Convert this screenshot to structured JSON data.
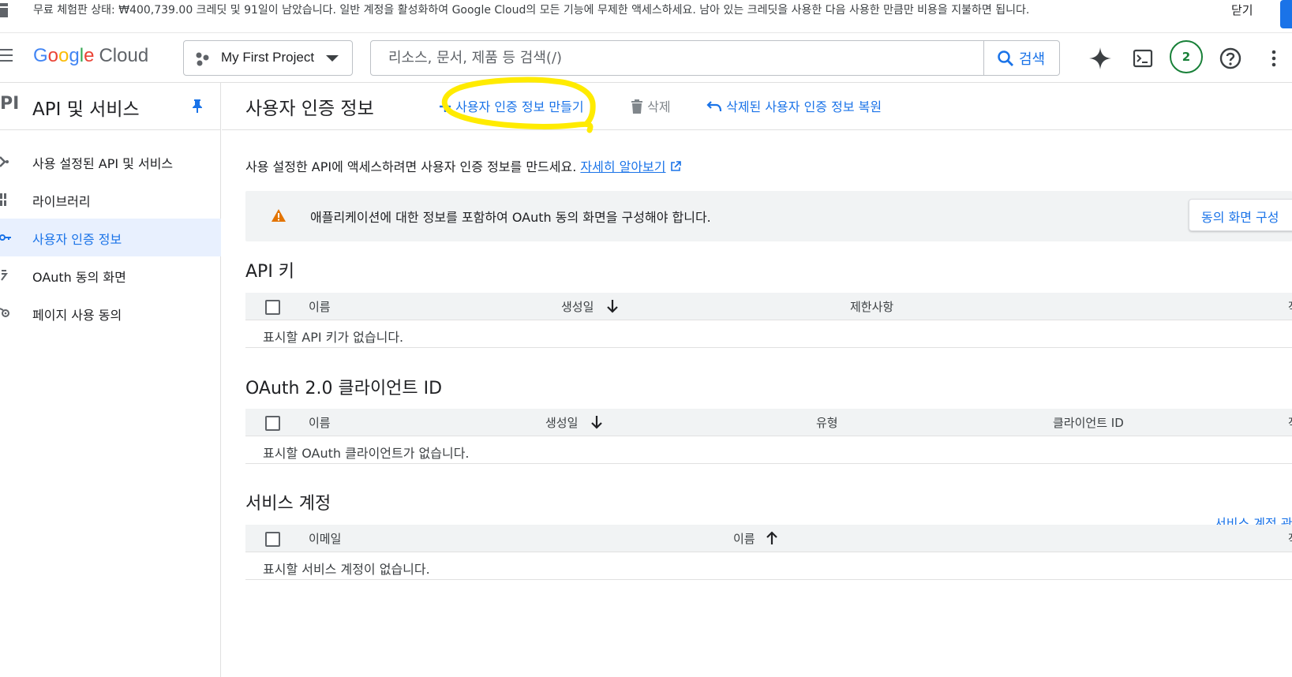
{
  "banner": {
    "message": "무료 체험판 상태: ₩400,739.00 크레딧 및 91일이 남았습니다. 일반 계정을 활성화하여 Google Cloud의 모든 기능에 무제한 액세스하세요. 남아 있는 크레딧을 사용한 다음 사용한 만큼만 비용을 지불하면 됩니다.",
    "close_label": "닫기"
  },
  "topbar": {
    "logo_google": "Google",
    "logo_cloud": "Cloud",
    "project_name": "My First Project",
    "search_placeholder": "리소스, 문서, 제품 등 검색(/)",
    "search_button": "검색",
    "notifications_count": "2",
    "icons": [
      "menu-icon",
      "gemini-icon",
      "cloud-shell-icon",
      "help-icon",
      "more-vert-icon"
    ]
  },
  "sidebar": {
    "api_badge": "PI",
    "title": "API 및 서비스",
    "items": [
      {
        "label": "사용 설정된 API 및 서비스",
        "icon": "enabled-apis-icon",
        "active": false
      },
      {
        "label": "라이브러리",
        "icon": "library-icon",
        "active": false
      },
      {
        "label": "사용자 인증 정보",
        "icon": "key-icon",
        "active": true
      },
      {
        "label": "OAuth 동의 화면",
        "icon": "oauth-icon",
        "active": false
      },
      {
        "label": "페이지 사용 동의",
        "icon": "settings-icon",
        "active": false
      }
    ]
  },
  "main": {
    "title": "사용자 인증 정보",
    "actions": {
      "create": "사용자 인증 정보 만들기",
      "delete": "삭제",
      "restore": "삭제된 사용자 인증 정보 복원"
    },
    "intro_text": "사용 설정한 API에 액세스하려면 사용자 인증 정보를 만드세요.",
    "intro_link": "자세히 알아보기",
    "warning_text": "애플리케이션에 대한 정보를 포함하여 OAuth 동의 화면을 구성해야 합니다.",
    "warning_button": "동의 화면 구성",
    "api_keys": {
      "title": "API 키",
      "columns": [
        "이름",
        "생성일",
        "제한사항",
        "작"
      ],
      "empty": "표시할 API 키가 없습니다."
    },
    "oauth_clients": {
      "title": "OAuth 2.0 클라이언트 ID",
      "columns": [
        "이름",
        "생성일",
        "유형",
        "클라이언트 ID",
        "작"
      ],
      "empty": "표시할 OAuth 클라이언트가 없습니다."
    },
    "service_accounts": {
      "title": "서비스 계정",
      "manage_link": "서비스 계정 관리",
      "columns": [
        "이메일",
        "이름",
        "작"
      ],
      "empty": "표시할 서비스 계정이 없습니다."
    }
  },
  "colors": {
    "accent": "#1a73e8",
    "active_bg": "#e8f0fe",
    "warning": "#e37400",
    "highlight": "#ffeb00",
    "notification": "#188038"
  }
}
